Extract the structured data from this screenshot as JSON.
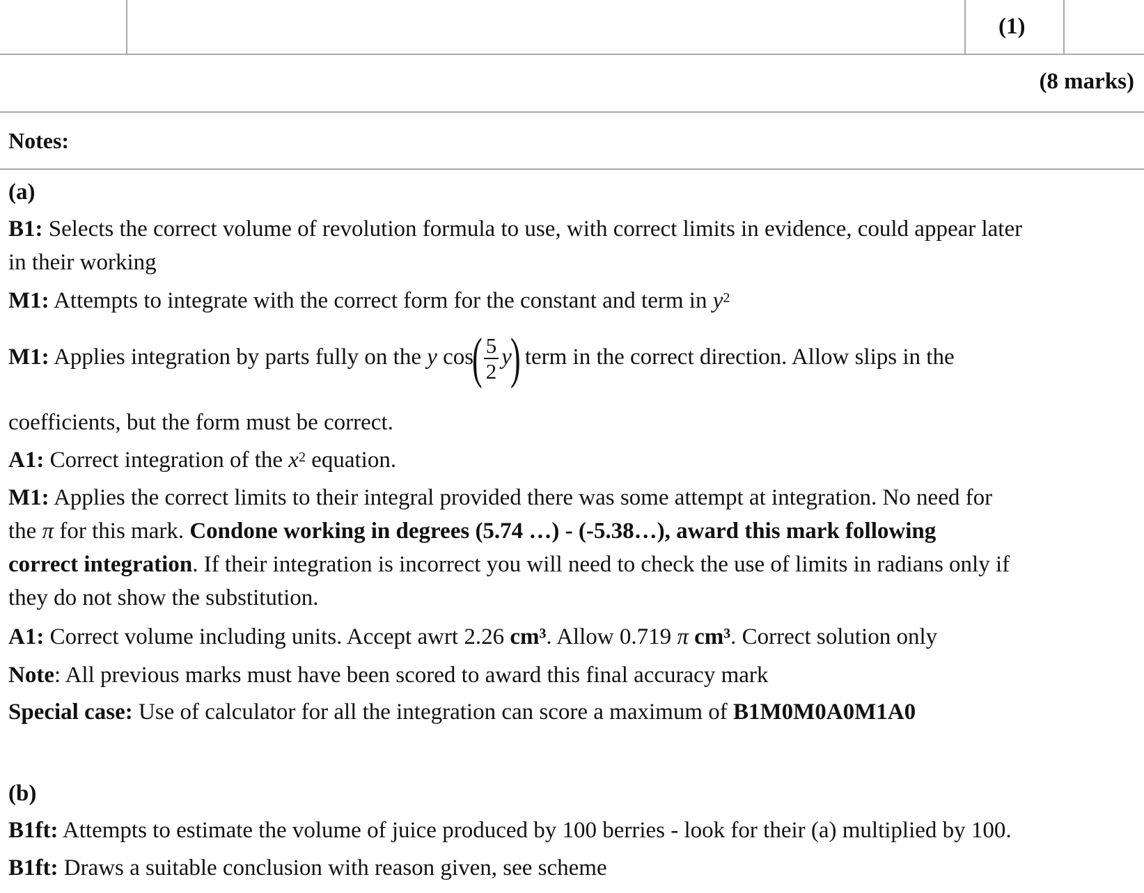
{
  "header_row": {
    "mark": "(1)"
  },
  "total_marks": "(8 marks)",
  "notes_label": "Notes:",
  "part_a": {
    "label": "(a)",
    "b1": {
      "code": "B1:",
      "line1": "Selects the correct volume of revolution formula to use, with correct limits in evidence, could appear later",
      "line2": "in their working"
    },
    "m1_integrate": {
      "code": "M1:",
      "text": "Attempts to integrate with the correct form for the constant and term in ",
      "var": "y",
      "exp": "2"
    },
    "m1_parts": {
      "code": "M1:",
      "pre": "Applies integration by parts fully on the ",
      "y": "y",
      "cos": "cos",
      "lparen": "(",
      "num": "5",
      "den": "2",
      "y2": "y",
      "rparen": ")",
      "post": "term in the correct direction. Allow slips in the",
      "line2": "coefficients, but the form must be correct."
    },
    "a1_integration": {
      "code": "A1:",
      "pre": "Correct integration of the ",
      "var": "x",
      "exp": "2",
      "post": " equation."
    },
    "m1_limits": {
      "code": "M1:",
      "line1": "Applies the correct limits to their integral provided there was some attempt at integration. No need for",
      "line2_pre": "the ",
      "pi": "π",
      "line2_mid": " for this mark. ",
      "line2_bold": "Condone working in degrees (5.74 …) - (-5.38…), award this mark following",
      "line3_bold": "correct integration",
      "line3_rest": ". If their integration is incorrect you will need to check the use of limits in radians only if",
      "line4": "they do not show the substitution."
    },
    "a1_volume": {
      "code": "A1:",
      "pre": "Correct volume including units. Accept awrt 2.26 ",
      "unit1": "cm³",
      "mid": ".  Allow 0.719 ",
      "pi": "π",
      "unit2": "cm³",
      "post": ". Correct solution only"
    },
    "note": {
      "label": "Note",
      "text": ": All previous marks must have been scored to award this final accuracy mark"
    },
    "special_case": {
      "label": "Special case:",
      "text": " Use of calculator for all the integration can score a maximum of ",
      "code": "B1M0M0A0M1A0"
    }
  },
  "part_b": {
    "label": "(b)",
    "b1ft_1": {
      "code": "B1ft:",
      "text": " Attempts to estimate the volume of juice produced by 100 berries - look for their (a) multiplied by 100."
    },
    "b1ft_2": {
      "code": "B1ft:",
      "text": " Draws a suitable conclusion with reason given, see scheme"
    }
  }
}
